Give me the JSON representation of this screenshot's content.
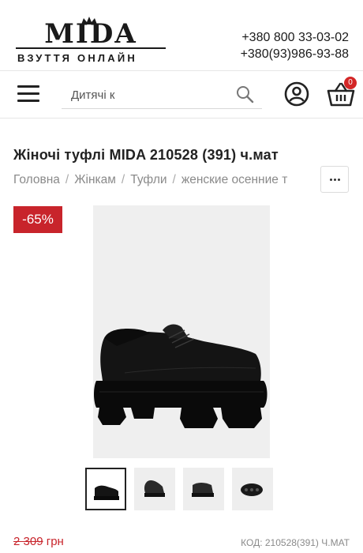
{
  "header": {
    "logo_text": "MIDA",
    "logo_tagline": "ВЗУТТЯ ОНЛАЙН",
    "phone_1": "+380 800 33-03-02",
    "phone_2": "+380(93)986-93-88"
  },
  "toolbar": {
    "menu_icon": "hamburger-menu-icon",
    "search_value": "Дитячі к",
    "search_icon": "search-icon",
    "account_icon": "user-circle-icon",
    "cart_icon": "basket-icon",
    "cart_count": "0",
    "cart_badge_color": "#d32626"
  },
  "product": {
    "title": "Жіночі туфлі MIDA 210528 (391) ч.мат",
    "breadcrumbs": [
      "Головна",
      "Жінкам",
      "Туфли",
      "женские осенние т"
    ],
    "more_icon": "more-horizontal-icon",
    "discount_label": "-65%",
    "discount_color": "#c8242b",
    "old_price": "2 309",
    "currency": "грн",
    "sku_label": "КОД:",
    "sku_value": "210528(391) Ч.МАТ",
    "thumbnails": [
      "side-view",
      "angle-view",
      "front-angle-view",
      "sole-view"
    ]
  }
}
